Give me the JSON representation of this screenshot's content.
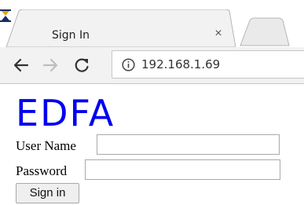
{
  "browser": {
    "tab_title": "Sign In",
    "tab_close_glyph": "×",
    "favicon": "hourglass-icon",
    "url": "192.168.1.69",
    "icons": [
      "back-arrow-icon",
      "forward-arrow-icon",
      "reload-icon",
      "info-icon"
    ]
  },
  "page": {
    "logo_text": "EDFA",
    "logo_color": "#0000ee",
    "username_label": "User Name",
    "username_value": "",
    "password_label": "Password",
    "password_value": "",
    "signin_label": "Sign in"
  }
}
